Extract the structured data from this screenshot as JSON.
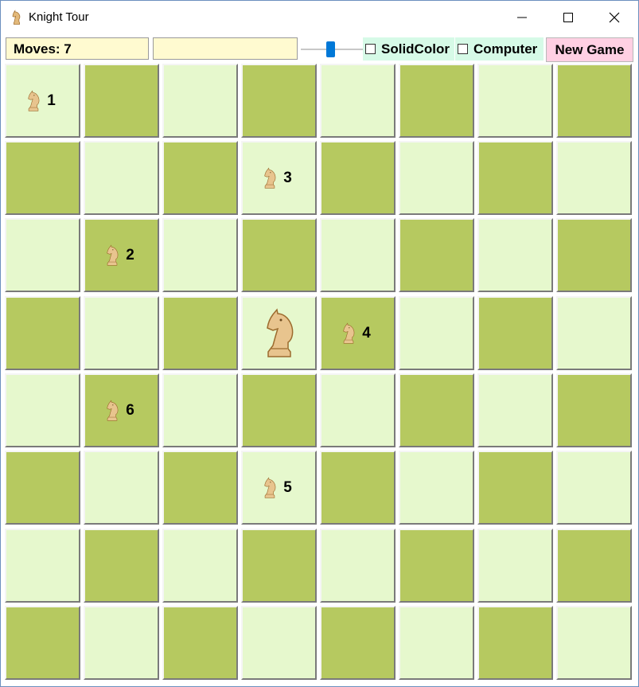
{
  "window": {
    "title": "Knight Tour",
    "icon": "knight-icon",
    "controls": [
      "minimize-icon",
      "maximize-icon",
      "close-icon"
    ]
  },
  "toolbar": {
    "moves_label": "Moves: 7",
    "status_text": "",
    "speed_slider_value": 0.5,
    "solid_color_label": "SolidColor",
    "solid_color_checked": false,
    "computer_label": "Computer",
    "computer_checked": false,
    "new_game_label": "New Game"
  },
  "colors": {
    "light_square": "#e6f8cd",
    "dark_square": "#b6c960",
    "info_box": "#fffad0",
    "checkbox_panel": "#d6fae7",
    "new_game_button": "#ffd0e3",
    "piece": "#e8c48e"
  },
  "board": {
    "size": 8,
    "top_left_color": "light",
    "current_knight": {
      "row": 3,
      "col": 3
    },
    "visited": [
      {
        "row": 0,
        "col": 0,
        "label": "1"
      },
      {
        "row": 2,
        "col": 1,
        "label": "2"
      },
      {
        "row": 1,
        "col": 3,
        "label": "3"
      },
      {
        "row": 3,
        "col": 4,
        "label": "4"
      },
      {
        "row": 5,
        "col": 3,
        "label": "5"
      },
      {
        "row": 4,
        "col": 1,
        "label": "6"
      }
    ]
  }
}
